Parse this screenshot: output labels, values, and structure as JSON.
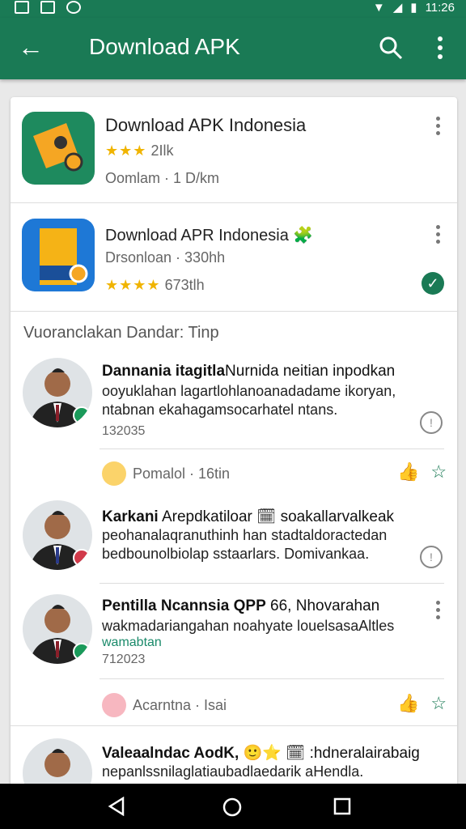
{
  "status_bar": {
    "time": "11:26"
  },
  "toolbar": {
    "title": "Download APK"
  },
  "apps": [
    {
      "name": "Download APK Indonesia",
      "rating_text": "2Ilk",
      "meta": "Oomlam · 1 D/km"
    },
    {
      "name": "Download APR Indonesia",
      "sub": "Drsonloan · 330hh",
      "rating_text": "673tlh"
    }
  ],
  "section_title": "Vuoranclakan Dandar: Tinp",
  "reviews": [
    {
      "title": "Dannania itagitla",
      "title_rest": "Nurnida neitian inpodkan",
      "body": "ooyuklahan lagartlohlanoanadadame ikoryan, ntabnan ekahagamsocarhatel ntans.",
      "date": "132035",
      "footer": "Pomalol · 16tin"
    },
    {
      "title": "Karkani",
      "title_rest": "Arepdkatiloar 🗓 soakallarvalkeak",
      "body": "peohanalaqranuthinh han stadtaldoractedan bedbounolbiolap sstaarlars. Domivankaa.",
      "date": "",
      "footer": ""
    },
    {
      "title": "Pentilla Ncannsia QPP",
      "title_rest": "66, Nhovarahan",
      "body": "wakmadariangahan noahyate louelsasaAltles",
      "link": "wamabtan",
      "date": "712023",
      "footer": "Acarntna · Isai"
    },
    {
      "title": "Valeaalndac AodK,",
      "title_rest": "🙂⭐ 🗓 :hdneralairabaig",
      "body": "nepanlssnilaglatiaubadlaedarik aHendla.",
      "date": "",
      "footer": ""
    }
  ],
  "colors": {
    "primary": "#1a7a55",
    "star": "#f0b400",
    "text": "#212121"
  }
}
